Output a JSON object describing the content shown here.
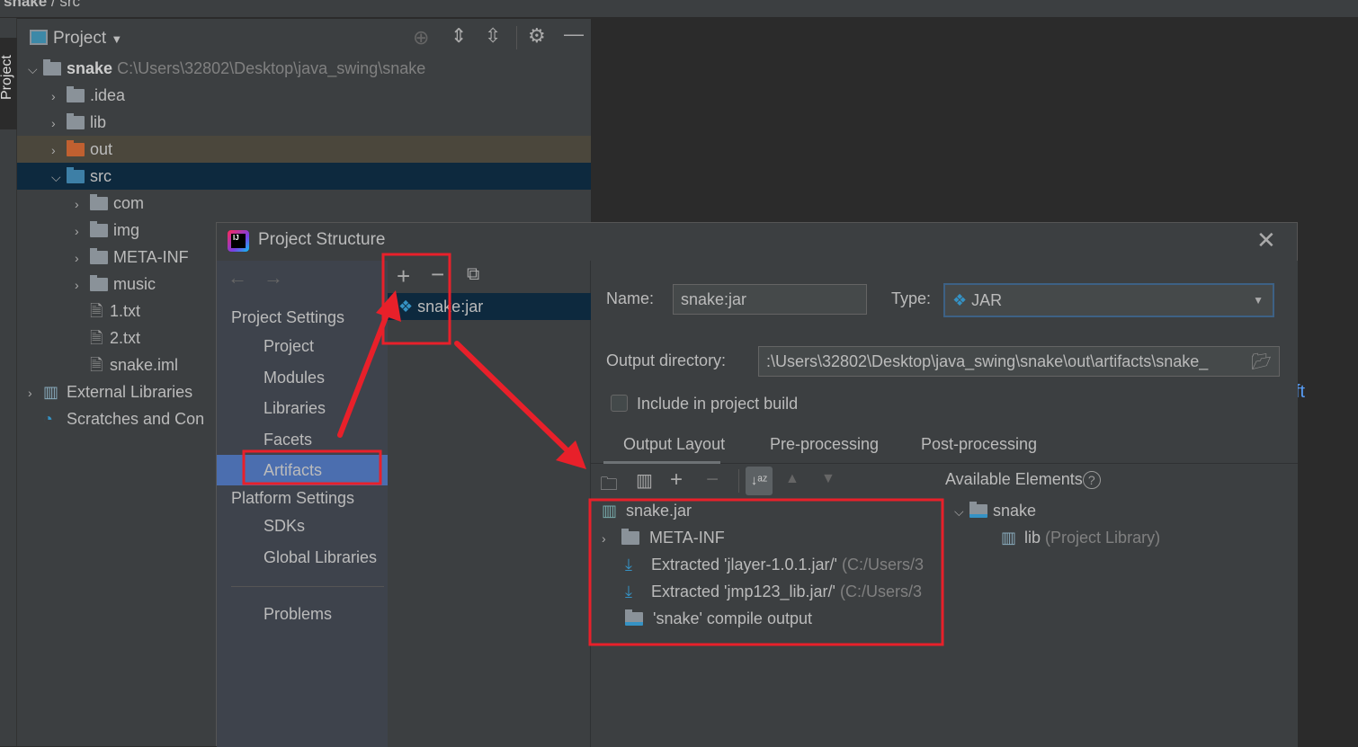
{
  "breadcrumb": {
    "project": "snake",
    "folder": "src"
  },
  "side_stripe": {
    "project_tab": "Project"
  },
  "project_panel": {
    "title": "Project",
    "root": {
      "name": "snake",
      "path": "C:\\Users\\32802\\Desktop\\java_swing\\snake"
    },
    "items": [
      {
        "label": ".idea",
        "depth": 1,
        "type": "folder"
      },
      {
        "label": "lib",
        "depth": 1,
        "type": "folder"
      },
      {
        "label": "out",
        "depth": 1,
        "type": "excluded-folder"
      },
      {
        "label": "src",
        "depth": 1,
        "type": "source-folder",
        "expanded": true
      },
      {
        "label": "com",
        "depth": 2,
        "type": "package"
      },
      {
        "label": "img",
        "depth": 2,
        "type": "package"
      },
      {
        "label": "META-INF",
        "depth": 2,
        "type": "folder"
      },
      {
        "label": "music",
        "depth": 2,
        "type": "package"
      },
      {
        "label": "1.txt",
        "depth": 2,
        "type": "file"
      },
      {
        "label": "2.txt",
        "depth": 2,
        "type": "file"
      },
      {
        "label": "snake.iml",
        "depth": 2,
        "type": "file"
      },
      {
        "label": "External Libraries",
        "depth": 0,
        "type": "library"
      },
      {
        "label": "Scratches and Con",
        "depth": 0,
        "type": "scratches"
      }
    ]
  },
  "editor_fragment": "ft",
  "dialog": {
    "title": "Project Structure",
    "sidebar": {
      "project_settings": "Project Settings",
      "ps_items": [
        "Project",
        "Modules",
        "Libraries",
        "Facets",
        "Artifacts"
      ],
      "platform_settings": "Platform Settings",
      "pl_items": [
        "SDKs",
        "Global Libraries"
      ],
      "problems": "Problems",
      "selected": "Artifacts"
    },
    "artifacts": [
      "snake:jar"
    ],
    "name_label": "Name:",
    "name_value": "snake:jar",
    "type_label": "Type:",
    "type_value": "JAR",
    "output_dir_label": "Output directory:",
    "output_dir_value": ":\\Users\\32802\\Desktop\\java_swing\\snake\\out\\artifacts\\snake_",
    "include_build_label": "Include in project build",
    "include_build_checked": false,
    "tabs": [
      "Output Layout",
      "Pre-processing",
      "Post-processing"
    ],
    "active_tab": "Output Layout",
    "layout_tree": [
      {
        "label": "snake.jar",
        "hint": ""
      },
      {
        "label": "META-INF",
        "hint": ""
      },
      {
        "label": "Extracted 'jlayer-1.0.1.jar/'",
        "hint": "(C:/Users/3"
      },
      {
        "label": "Extracted 'jmp123_lib.jar/'",
        "hint": "(C:/Users/3"
      },
      {
        "label": "'snake' compile output",
        "hint": ""
      }
    ],
    "available_label": "Available Elements",
    "available": [
      {
        "label": "snake",
        "hint": ""
      },
      {
        "label": "lib",
        "hint": "(Project Library)"
      }
    ]
  },
  "colors": {
    "annotation": "#e8202a",
    "selection": "#0d293e",
    "sidebar_selected": "#4b6eaf",
    "accent": "#3592c4"
  }
}
